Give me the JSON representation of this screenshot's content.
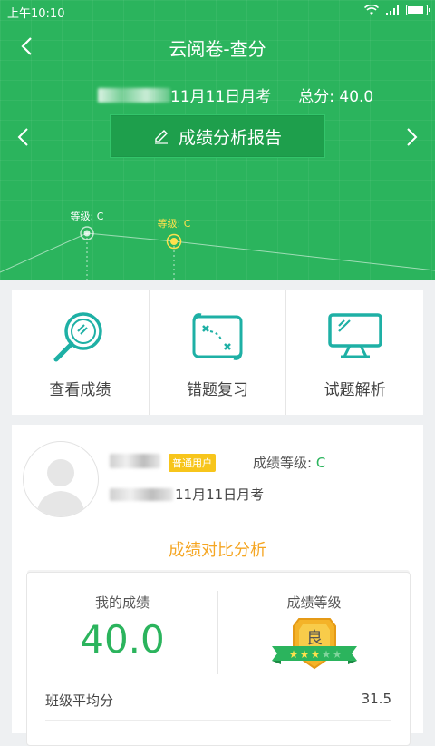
{
  "status_bar": {
    "time": "上午10:10"
  },
  "header": {
    "title": "云阅卷-查分",
    "exam_name": "11月11日月考",
    "total_score": "总分: 40.0",
    "report_button": "成绩分析报告"
  },
  "chart_data": {
    "type": "line",
    "points": [
      {
        "label": "等级: C",
        "highlighted": false
      },
      {
        "label": "等级: C",
        "highlighted": true
      }
    ]
  },
  "tiles": [
    {
      "label": "查看成绩",
      "icon": "magnifier-icon"
    },
    {
      "label": "错题复习",
      "icon": "map-icon"
    },
    {
      "label": "试题解析",
      "icon": "monitor-icon"
    }
  ],
  "user": {
    "badge": "普通用户",
    "grade_label": "成绩等级: ",
    "grade_value": "C",
    "exam_name": "11月11日月考"
  },
  "compare": {
    "section_title": "成绩对比分析",
    "my_score_title": "我的成绩",
    "my_score": "40.0",
    "grade_title": "成绩等级",
    "grade_medal": "良",
    "grade_stars": 3,
    "grade_stars_total": 5,
    "class_avg_label": "班级平均分",
    "class_avg_value": "31.5"
  },
  "colors": {
    "primary_green": "#2bb45d",
    "accent_orange": "#f5a623",
    "badge_yellow": "#f7c51b",
    "tile_teal": "#1eb0a5"
  }
}
